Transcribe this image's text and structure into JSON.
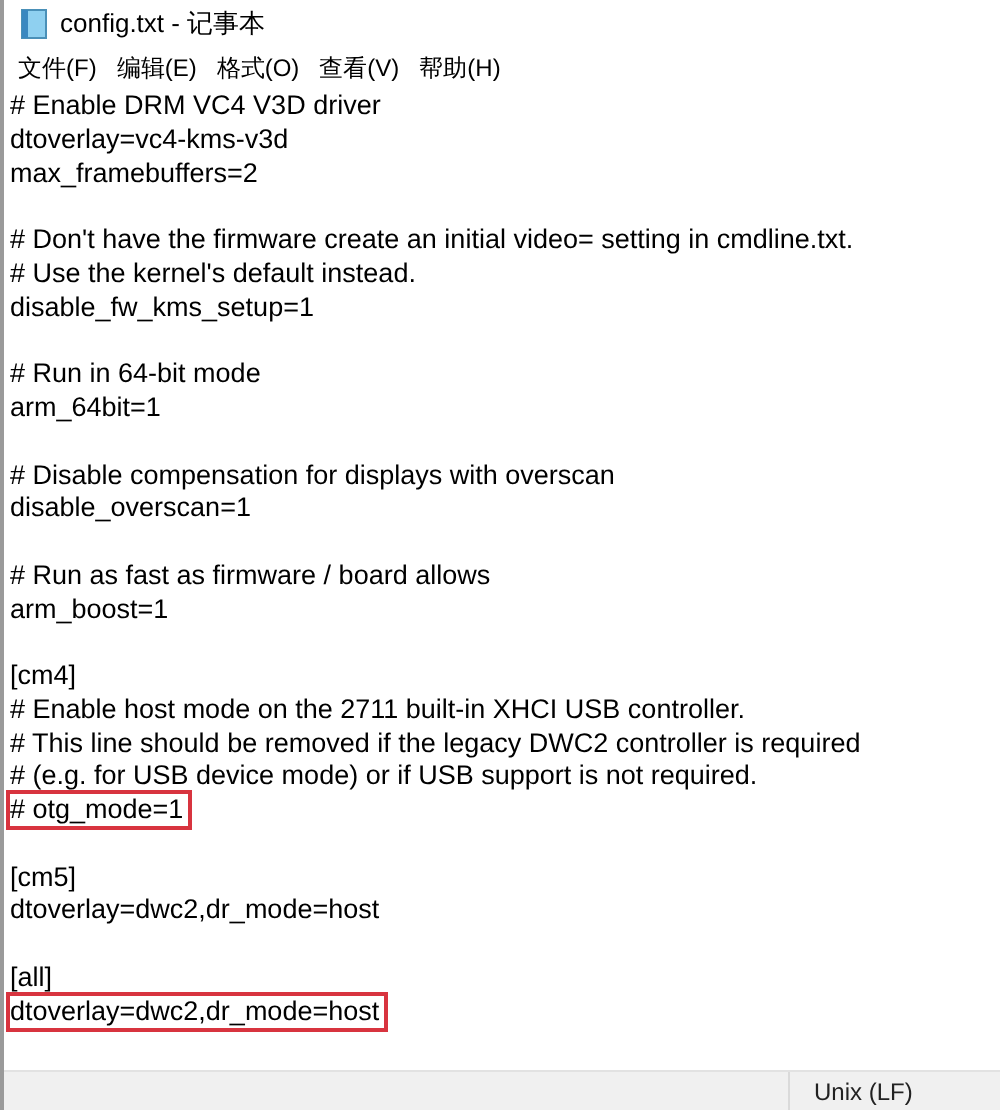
{
  "window": {
    "title": "config.txt - 记事本"
  },
  "menu": [
    "文件(F)",
    "编辑(E)",
    "格式(O)",
    "查看(V)",
    "帮助(H)"
  ],
  "lines": [
    {
      "kind": "text",
      "text": "# Enable DRM VC4 V3D driver",
      "highlighted": false
    },
    {
      "kind": "text",
      "text": "dtoverlay=vc4-kms-v3d",
      "highlighted": false
    },
    {
      "kind": "text",
      "text": "max_framebuffers=2",
      "highlighted": false
    },
    {
      "kind": "blank"
    },
    {
      "kind": "text",
      "text": "# Don't have the firmware create an initial video= setting in cmdline.txt.",
      "highlighted": false
    },
    {
      "kind": "text",
      "text": "# Use the kernel's default instead.",
      "highlighted": false
    },
    {
      "kind": "text",
      "text": "disable_fw_kms_setup=1",
      "highlighted": false
    },
    {
      "kind": "blank"
    },
    {
      "kind": "text",
      "text": "# Run in 64-bit mode",
      "highlighted": false
    },
    {
      "kind": "text",
      "text": "arm_64bit=1",
      "highlighted": false
    },
    {
      "kind": "blank"
    },
    {
      "kind": "text",
      "text": "# Disable compensation for displays with overscan",
      "highlighted": false
    },
    {
      "kind": "text",
      "text": "disable_overscan=1",
      "highlighted": false
    },
    {
      "kind": "blank"
    },
    {
      "kind": "text",
      "text": "# Run as fast as firmware / board allows",
      "highlighted": false
    },
    {
      "kind": "text",
      "text": "arm_boost=1",
      "highlighted": false
    },
    {
      "kind": "blank"
    },
    {
      "kind": "text",
      "text": "[cm4]",
      "highlighted": false
    },
    {
      "kind": "text",
      "text": "# Enable host mode on the 2711 built-in XHCI USB controller.",
      "highlighted": false
    },
    {
      "kind": "text",
      "text": "# This line should be removed if the legacy DWC2 controller is required",
      "highlighted": false
    },
    {
      "kind": "text",
      "text": "# (e.g. for USB device mode) or if USB support is not required.",
      "highlighted": false
    },
    {
      "kind": "text",
      "text": "# otg_mode=1",
      "highlighted": true
    },
    {
      "kind": "blank"
    },
    {
      "kind": "text",
      "text": "[cm5]",
      "highlighted": false
    },
    {
      "kind": "text",
      "text": "dtoverlay=dwc2,dr_mode=host",
      "highlighted": false
    },
    {
      "kind": "blank"
    },
    {
      "kind": "text",
      "text": "[all]",
      "highlighted": false
    },
    {
      "kind": "text",
      "text": "dtoverlay=dwc2,dr_mode=host",
      "highlighted": true
    }
  ],
  "status_bar": {
    "line_ending": "Unix (LF)"
  }
}
